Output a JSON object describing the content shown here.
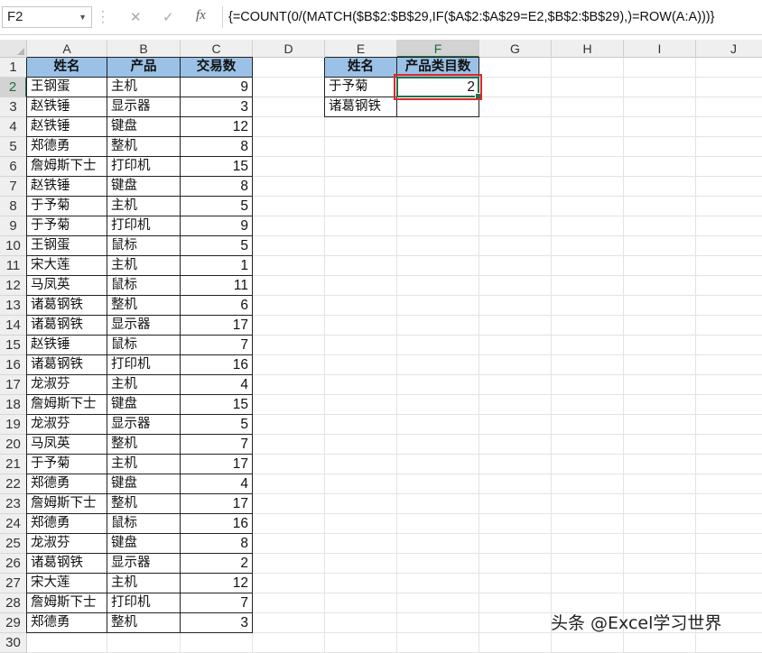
{
  "formula_bar": {
    "name_box": "F2",
    "cancel_icon": "✕",
    "enter_icon": "✓",
    "fx_label": "fx",
    "formula": "{=COUNT(0/(MATCH($B$2:$B$29,IF($A$2:$A$29=E2,$B$2:$B$29),)=ROW(A:A)))}"
  },
  "columns": [
    "A",
    "B",
    "C",
    "D",
    "E",
    "F",
    "G",
    "H",
    "I",
    "J"
  ],
  "rows": [
    "1",
    "2",
    "3",
    "4",
    "5",
    "6",
    "7",
    "8",
    "9",
    "10",
    "11",
    "12",
    "13",
    "14",
    "15",
    "16",
    "17",
    "18",
    "19",
    "20",
    "21",
    "22",
    "23",
    "24",
    "25",
    "26",
    "27",
    "28",
    "29",
    "30"
  ],
  "table1": {
    "headers": [
      "姓名",
      "产品",
      "交易数"
    ],
    "rows": [
      [
        "王钢蛋",
        "主机",
        "9"
      ],
      [
        "赵铁锤",
        "显示器",
        "3"
      ],
      [
        "赵铁锤",
        "键盘",
        "12"
      ],
      [
        "郑德勇",
        "整机",
        "8"
      ],
      [
        "詹姆斯下士",
        "打印机",
        "15"
      ],
      [
        "赵铁锤",
        "键盘",
        "8"
      ],
      [
        "于予菊",
        "主机",
        "5"
      ],
      [
        "于予菊",
        "打印机",
        "9"
      ],
      [
        "王钢蛋",
        "鼠标",
        "5"
      ],
      [
        "宋大莲",
        "主机",
        "1"
      ],
      [
        "马凤英",
        "鼠标",
        "11"
      ],
      [
        "诸葛钢铁",
        "整机",
        "6"
      ],
      [
        "诸葛钢铁",
        "显示器",
        "17"
      ],
      [
        "赵铁锤",
        "鼠标",
        "7"
      ],
      [
        "诸葛钢铁",
        "打印机",
        "16"
      ],
      [
        "龙淑芬",
        "主机",
        "4"
      ],
      [
        "詹姆斯下士",
        "键盘",
        "15"
      ],
      [
        "龙淑芬",
        "显示器",
        "5"
      ],
      [
        "马凤英",
        "整机",
        "7"
      ],
      [
        "于予菊",
        "主机",
        "17"
      ],
      [
        "郑德勇",
        "键盘",
        "4"
      ],
      [
        "詹姆斯下士",
        "整机",
        "17"
      ],
      [
        "郑德勇",
        "鼠标",
        "16"
      ],
      [
        "龙淑芬",
        "键盘",
        "8"
      ],
      [
        "诸葛钢铁",
        "显示器",
        "2"
      ],
      [
        "宋大莲",
        "主机",
        "12"
      ],
      [
        "詹姆斯下士",
        "打印机",
        "7"
      ],
      [
        "郑德勇",
        "整机",
        "3"
      ]
    ]
  },
  "table2": {
    "headers": [
      "姓名",
      "产品类目数"
    ],
    "rows": [
      [
        "于予菊",
        "2"
      ],
      [
        "诸葛钢铁",
        ""
      ]
    ]
  },
  "watermark": "头条 @Excel学习世界",
  "colors": {
    "header_fill": "#9bc2e6",
    "active_border": "#217346",
    "highlight": "#e0262d"
  }
}
